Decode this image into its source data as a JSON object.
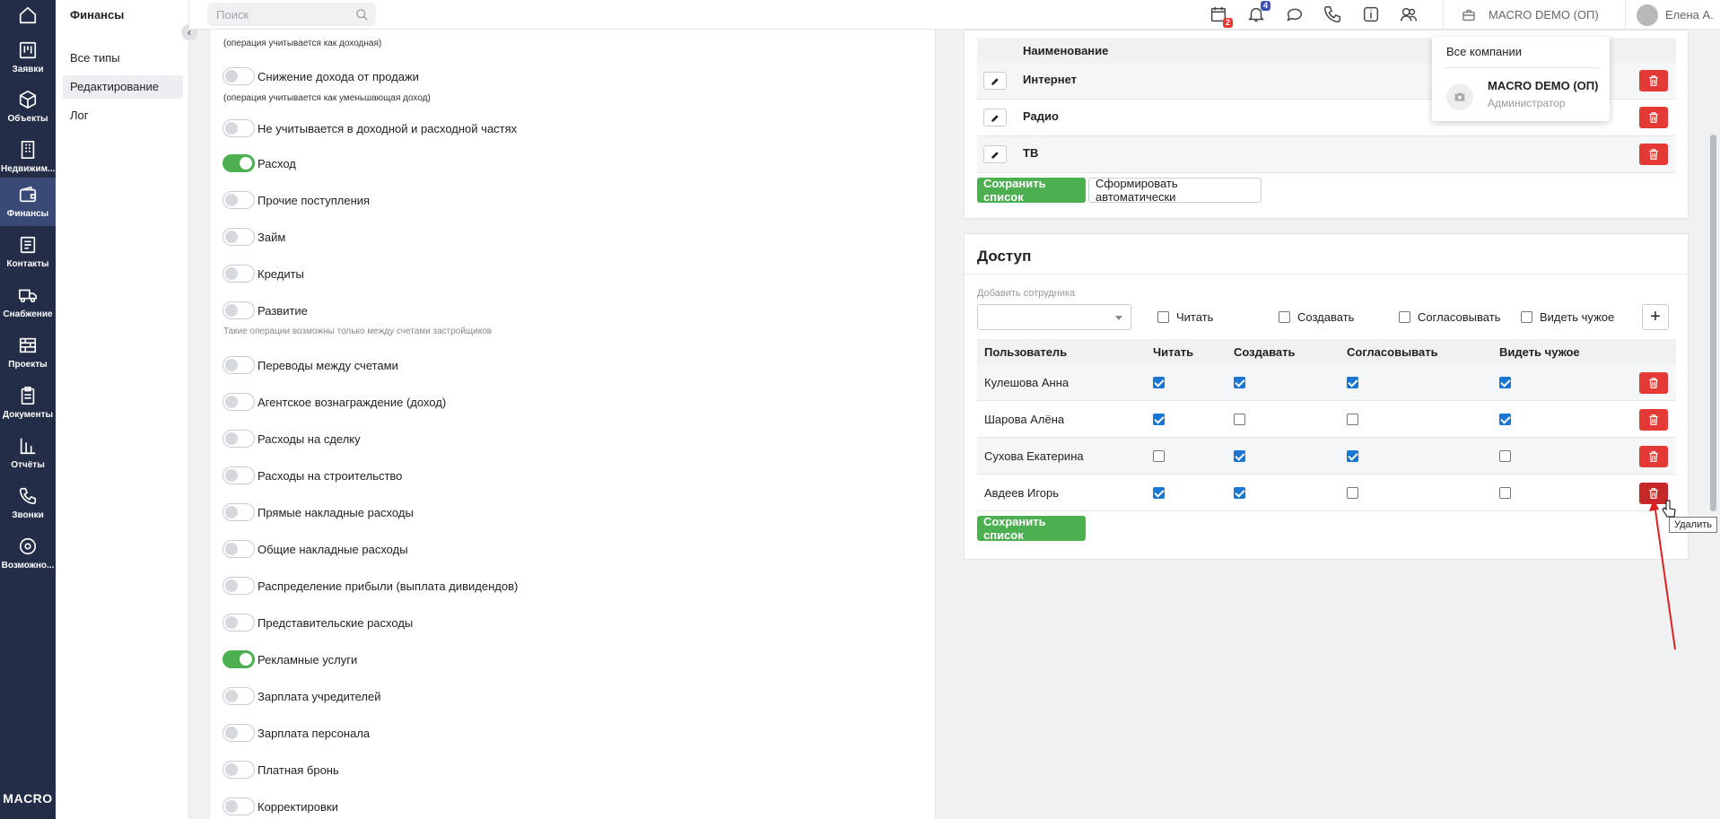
{
  "nav": {
    "items": [
      {
        "label": "",
        "icon": "home-icon"
      },
      {
        "label": "Заявки",
        "icon": "kanban-icon"
      },
      {
        "label": "Объекты",
        "icon": "cube-icon"
      },
      {
        "label": "Недвижим...",
        "icon": "building-icon"
      },
      {
        "label": "Финансы",
        "icon": "wallet-icon"
      },
      {
        "label": "Контакты",
        "icon": "contacts-icon"
      },
      {
        "label": "Снабжение",
        "icon": "truck-icon"
      },
      {
        "label": "Проекты",
        "icon": "brick-icon"
      },
      {
        "label": "Документы",
        "icon": "clipboard-icon"
      },
      {
        "label": "Отчёты",
        "icon": "bar-chart-icon"
      },
      {
        "label": "Звонки",
        "icon": "phone-icon"
      },
      {
        "label": "Возможно...",
        "icon": "gear-icon"
      }
    ],
    "brand": "MACRO"
  },
  "subnav": {
    "title": "Финансы",
    "items": [
      "Все типы",
      "Редактирование",
      "Лог"
    ]
  },
  "topbar": {
    "search_placeholder": "Поиск",
    "calendar_badge": "2",
    "bell_badge": "4",
    "company": "MACRO DEMO (ОП)",
    "user": "Елена А."
  },
  "dropdown": {
    "all": "Все компании",
    "company_name": "MACRO DEMO (ОП)",
    "company_role": "Администратор"
  },
  "operations": {
    "top_note": "(операция учитывается как доходная)",
    "items": [
      {
        "label": "Снижение дохода от продажи",
        "on": false,
        "note": "(операция учитывается как уменьшающая доход)"
      },
      {
        "label": "Не учитывается в доходной и расходной частях",
        "on": false
      },
      {
        "label": "Расход",
        "on": true
      },
      {
        "label": "Прочие поступления",
        "on": false
      },
      {
        "label": "Займ",
        "on": false
      },
      {
        "label": "Кредиты",
        "on": false
      },
      {
        "label": "Развитие",
        "on": false,
        "note": "Такие операции возможны только между счетами застройщиков"
      },
      {
        "label": "Переводы между счетами",
        "on": false
      },
      {
        "label": "Агентское вознаграждение (доход)",
        "on": false
      },
      {
        "label": "Расходы на сделку",
        "on": false
      },
      {
        "label": "Расходы на строительство",
        "on": false
      },
      {
        "label": "Прямые накладные расходы",
        "on": false
      },
      {
        "label": "Общие накладные расходы",
        "on": false
      },
      {
        "label": "Распределение прибыли (выплата дивидендов)",
        "on": false
      },
      {
        "label": "Представительские расходы",
        "on": false
      },
      {
        "label": "Рекламные услуги",
        "on": true
      },
      {
        "label": "Зарплата учредителей",
        "on": false
      },
      {
        "label": "Зарплата персонала",
        "on": false
      },
      {
        "label": "Платная бронь",
        "on": false
      },
      {
        "label": "Корректировки",
        "on": false
      }
    ]
  },
  "list": {
    "header": "Наименование",
    "items": [
      "Интернет",
      "Радио",
      "ТВ"
    ],
    "save": "Сохранить список",
    "auto": "Сформировать автоматически"
  },
  "access": {
    "title": "Доступ",
    "add_label": "Добавить сотрудника",
    "options": [
      "Читать",
      "Создавать",
      "Согласовывать",
      "Видеть чужое"
    ],
    "columns": [
      "Пользователь",
      "Читать",
      "Создавать",
      "Согласовывать",
      "Видеть чужое"
    ],
    "rows": [
      {
        "user": "Кулешова Анна",
        "perms": [
          true,
          true,
          true,
          true
        ]
      },
      {
        "user": "Шарова Алёна",
        "perms": [
          true,
          false,
          false,
          true
        ]
      },
      {
        "user": "Сухова Екатерина",
        "perms": [
          false,
          true,
          true,
          false
        ]
      },
      {
        "user": "Авдеев Игорь",
        "perms": [
          true,
          true,
          false,
          false
        ]
      }
    ],
    "save": "Сохранить список",
    "tooltip": "Удалить"
  }
}
